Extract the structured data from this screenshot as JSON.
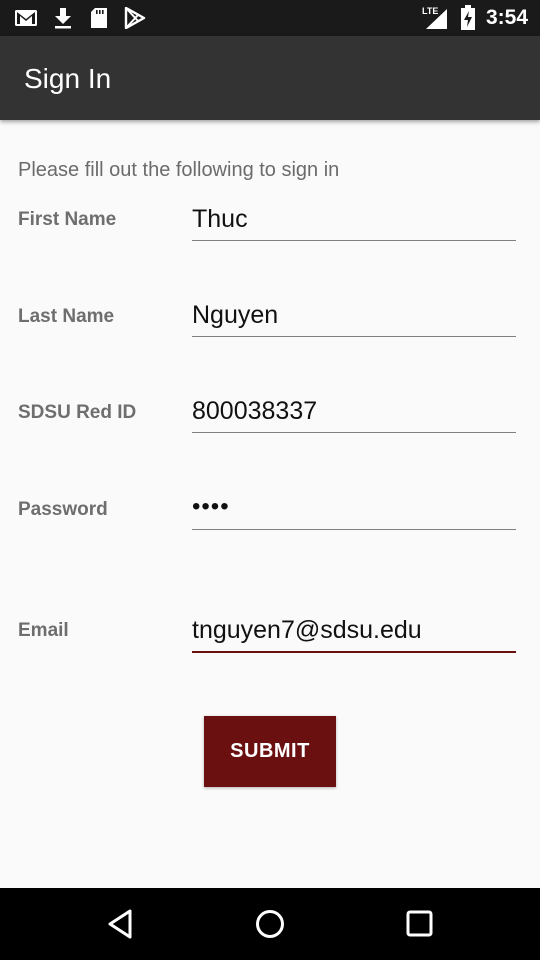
{
  "status_bar": {
    "network_label": "LTE",
    "time": "3:54",
    "icons": [
      "gmail-icon",
      "download-icon",
      "sd-card-icon",
      "play-store-icon",
      "signal-icon",
      "battery-charging-icon"
    ]
  },
  "app_bar": {
    "title": "Sign In"
  },
  "form": {
    "instructions": "Please fill out the following to sign in",
    "fields": [
      {
        "label": "First Name",
        "value": "Thuc"
      },
      {
        "label": "Last Name",
        "value": "Nguyen"
      },
      {
        "label": "SDSU Red ID",
        "value": "800038337"
      },
      {
        "label": "Password",
        "value": "••••"
      },
      {
        "label": "Email",
        "value": "tnguyen7@sdsu.edu"
      }
    ],
    "submit_label": "SUBMIT"
  },
  "navigation_bar": {
    "icons": [
      "back-icon",
      "home-icon",
      "recents-icon"
    ]
  },
  "colors": {
    "status_bar_bg": "#1a1a1a",
    "app_bar_bg": "#333333",
    "accent": "#6a1011",
    "background": "#fafafa"
  }
}
